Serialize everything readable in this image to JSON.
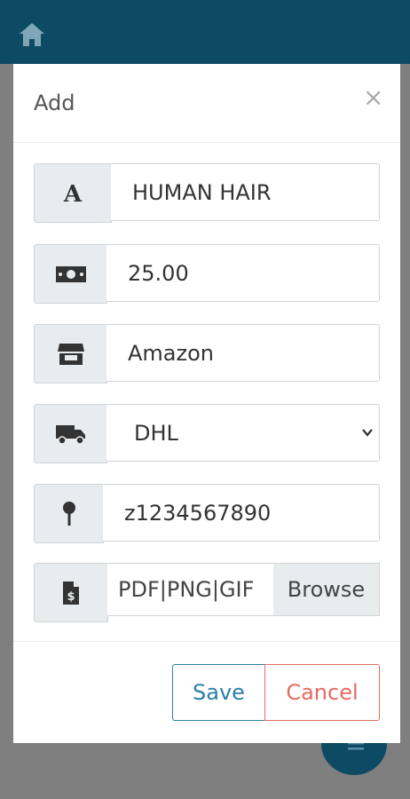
{
  "header": {
    "home_icon": "home-icon"
  },
  "modal": {
    "title": "Add",
    "close_label": "×",
    "fields": {
      "name": {
        "icon": "text-icon",
        "value": "HUMAN HAIR"
      },
      "price": {
        "icon": "money-icon",
        "value": "25.00"
      },
      "store": {
        "icon": "store-icon",
        "value": "Amazon"
      },
      "carrier": {
        "icon": "truck-icon",
        "value": "DHL"
      },
      "tracking": {
        "icon": "map-pin-icon",
        "value": "z1234567890"
      },
      "file": {
        "icon": "file-dollar-icon",
        "placeholder": "PDF|PNG|GIF",
        "browse_label": "Browse"
      }
    },
    "buttons": {
      "save": "Save",
      "cancel": "Cancel"
    }
  },
  "colors": {
    "brand": "#0d4a63",
    "save": "#2c7fa6",
    "cancel": "#e36b63"
  }
}
